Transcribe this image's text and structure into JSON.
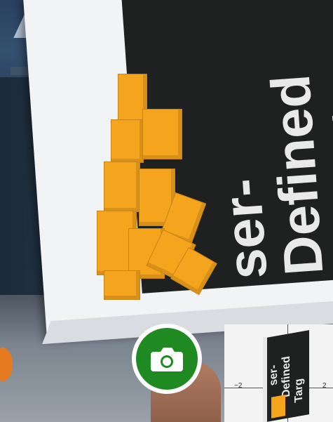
{
  "card": {
    "line1": "ser-",
    "line2": "Defined",
    "line3": "Target"
  },
  "capture": {
    "icon": "camera-icon",
    "color": "#1f8a22"
  },
  "preview": {
    "tick_left": "−2",
    "tick_right": "2",
    "label1": "ser-",
    "label2": "Defined",
    "label3": "Targ"
  },
  "colors": {
    "cube": "#f5a41e",
    "card_black": "#1f2020",
    "card_white": "#f1f3f5"
  }
}
